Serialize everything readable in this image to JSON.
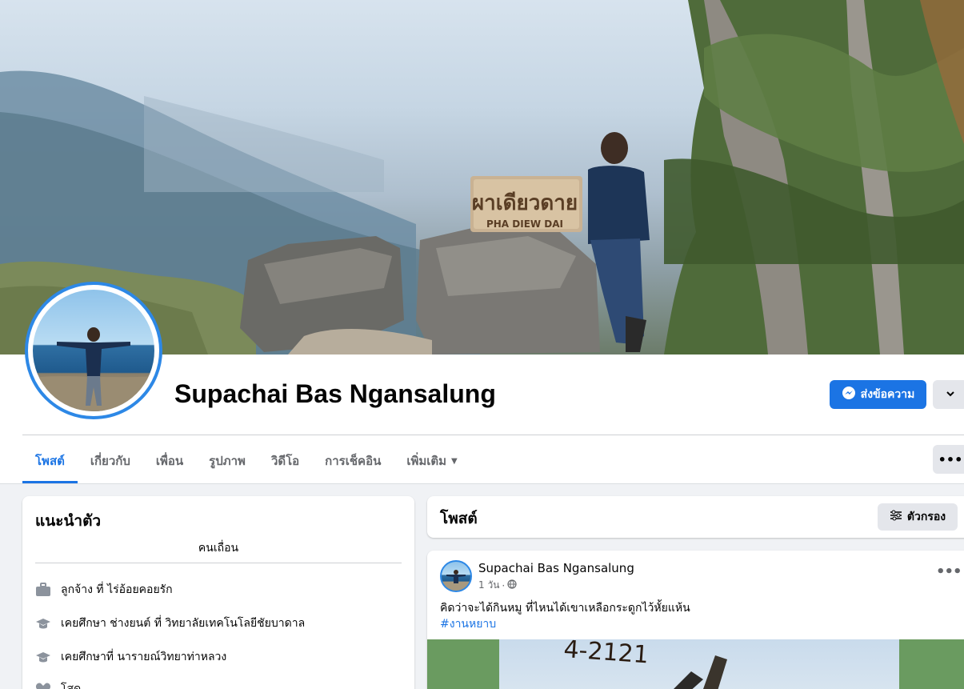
{
  "profile": {
    "name": "Supachai Bas Ngansalung",
    "message_button": "ส่งข้อความ",
    "cover_sign_thai": "ผาเดียวดาย",
    "cover_sign_en": "PHA DIEW DAI"
  },
  "tabs": [
    {
      "label": "โพสต์",
      "active": true
    },
    {
      "label": "เกี่ยวกับ"
    },
    {
      "label": "เพื่อน"
    },
    {
      "label": "รูปภาพ"
    },
    {
      "label": "วิดีโอ"
    },
    {
      "label": "การเช็คอิน"
    },
    {
      "label": "เพิ่มเติม"
    }
  ],
  "intro": {
    "title": "แนะนำตัว",
    "bio": "คนเถื่อน",
    "items": [
      {
        "icon": "briefcase-icon",
        "text": "ลูกจ้าง ที่ ไร่อ้อยคอยรัก"
      },
      {
        "icon": "graduation-cap-icon",
        "text": "เคยศึกษา ช่างยนต์ ที่ วิทยาลัยเทคโนโลยีชัยบาดาล"
      },
      {
        "icon": "graduation-cap-icon",
        "text": "เคยศึกษาที่ นารายณ์วิทยาท่าหลวง"
      },
      {
        "icon": "heart-icon",
        "text": "โสด"
      }
    ]
  },
  "posts_header": {
    "title": "โพสต์",
    "filter_label": "ตัวกรอง"
  },
  "post": {
    "author": "Supachai Bas Ngansalung",
    "time": "1 วัน",
    "separator": "·",
    "text": "คิดว่าจะได้กินหมู ที่ไหนได้เขาเหลือกระดูกไว้หั้ยแห้น",
    "hashtag": "#งานหยาบ",
    "media_text": "4-2121"
  },
  "colors": {
    "accent": "#1b74e4",
    "background": "#f0f2f5",
    "secondary_text": "#65676b"
  }
}
